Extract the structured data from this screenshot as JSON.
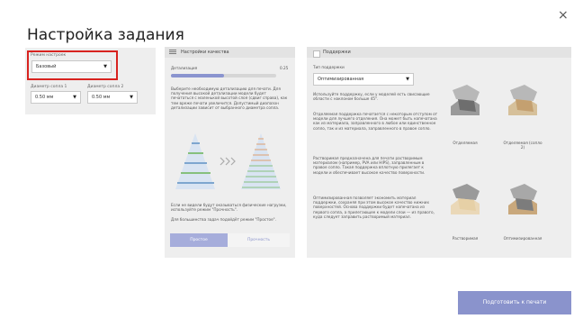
{
  "dialog": {
    "title": "Настройка задания",
    "close_symbol": "×"
  },
  "printer": {
    "mode_label": "Режим настроек",
    "mode_value": "Базовый",
    "nozzle1_label": "Диаметр сопла 1",
    "nozzle1_value": "0.50 мм",
    "nozzle2_label": "Диаметр сопла 2",
    "nozzle2_value": "0.50 мм"
  },
  "quality": {
    "header": "Настройки качества",
    "detail_label": "Детализация",
    "detail_value": "0.25",
    "detail_fill": 0.5,
    "desc": "Выберите необходимую детализацию для печати. Для получения высокой детализации модели будет печататься с маленькой высотой слоя (сдвиг справа), как тем вреже печати увеличится. Допустимый диапазон детализации зависит от выбранного диаметра сопла.",
    "hint": "Если не видели будут оказываться физические нагрузки, используйте режим \"Прочность\".",
    "hint2": "Для большинства задач подойдёт режим \"Простое\".",
    "btn_simple": "Простое",
    "btn_strength": "Прочность"
  },
  "supports": {
    "header": "Поддержки",
    "type_label": "Тип поддержки",
    "type_value": "Оптимизированная",
    "p1": "Используйте поддержку, если у моделей есть свисающие области с наклоном больше 45°.",
    "p2": "Отделяемая поддержка печатается с некоторым отступом от модели для лучшего отделения. Она может быть напечатана как из материала, заправленного в любое или единственное сопло, так и из материала, заправленного в правое сопло.",
    "p3": "Растворимая предназначена для печати растворимым материалом (например, PVA или HIPS), заправленным в правое сопло. Такая поддержка вплотную прилегает к модели и обеспечивает высокое качество поверхности.",
    "p4": "Оптимизированная позволяет экономить материал поддержки, сохраняя при этом высокое качество нижних поверхностей. Основа поддержки будет напечатана из первого сопла, а прилегающее к модели слои — из правого, куда следует заправить растворимый материал.",
    "thumbs": [
      {
        "caption": "Отделяемая"
      },
      {
        "caption": "Отделяемая (сопло 2)"
      },
      {
        "caption": "Растворимая"
      },
      {
        "caption": "Оптимизированная"
      }
    ]
  },
  "action_button": "Подготовить к печати",
  "colors": {
    "accent": "#8a93cc",
    "highlight_border": "#d8231f",
    "panel": "#eeeeee"
  }
}
